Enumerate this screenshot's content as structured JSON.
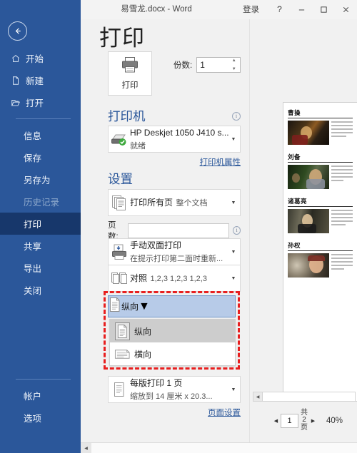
{
  "titlebar": {
    "document_title": "易雪龙.docx  -  Word",
    "sign_in": "登录",
    "help_icon": "?",
    "minimize_icon": "minimize-icon",
    "maximize_icon": "maximize-icon",
    "close_icon": "close-icon"
  },
  "page": {
    "heading": "打印"
  },
  "sidebar": {
    "back_icon": "back-arrow-icon",
    "top_items": [
      {
        "label": "开始",
        "icon": "home-icon"
      },
      {
        "label": "新建",
        "icon": "new-document-icon"
      },
      {
        "label": "打开",
        "icon": "open-folder-icon"
      }
    ],
    "main_items": [
      {
        "label": "信息",
        "state": "normal"
      },
      {
        "label": "保存",
        "state": "normal"
      },
      {
        "label": "另存为",
        "state": "normal"
      },
      {
        "label": "历史记录",
        "state": "disabled"
      },
      {
        "label": "打印",
        "state": "active"
      },
      {
        "label": "共享",
        "state": "normal"
      },
      {
        "label": "导出",
        "state": "normal"
      },
      {
        "label": "关闭",
        "state": "normal"
      }
    ],
    "bottom_items": [
      {
        "label": "帐户"
      },
      {
        "label": "选项"
      }
    ]
  },
  "print": {
    "print_button_label": "打印",
    "print_button_icon": "printer-icon",
    "copies_label": "份数:",
    "copies_value": "1",
    "printer_section_title": "打印机",
    "printer_info_icon": "info-icon",
    "printer_name": "HP Deskjet 1050 J410 s...",
    "printer_status": "就绪",
    "printer_properties_link": "打印机属性",
    "settings_section_title": "设置",
    "range": {
      "title": "打印所有页",
      "subtitle": "整个文档",
      "icon": "pages-icon"
    },
    "pages_label": "页数:",
    "pages_value": "",
    "pages_info_icon": "info-icon",
    "duplex": {
      "title": "手动双面打印",
      "subtitle": "在提示打印第二面时重新...",
      "icon": "duplex-printer-icon"
    },
    "collate": {
      "title": "对照",
      "subtitle": "1,2,3   1,2,3   1,2,3",
      "icon": "collate-icon"
    },
    "orientation": {
      "selected_label": "纵向",
      "selected_icon": "portrait-page-icon",
      "options": [
        {
          "label": "纵向",
          "icon": "portrait-page-icon",
          "selected": true
        },
        {
          "label": "横向",
          "icon": "landscape-page-icon",
          "selected": false
        }
      ],
      "highlight_color": "#e81f1f"
    },
    "scaling": {
      "title": "每版打印 1 页",
      "subtitle": "缩放到 14 厘米 x 20.3...",
      "icon": "scaling-icon"
    },
    "page_setup_link": "页面设置"
  },
  "preview": {
    "sections": [
      {
        "heading": "曹操"
      },
      {
        "heading": "刘备"
      },
      {
        "heading": "诸葛亮"
      },
      {
        "heading": "孙权"
      }
    ],
    "prev_icon": "prev-page-icon",
    "next_icon": "next-page-icon",
    "current_page": "1",
    "page_count_label": "共2页",
    "zoom_level": "40%"
  },
  "colors": {
    "backstage_blue": "#2b579a",
    "active_item_blue": "#17376b",
    "highlight_red": "#e81f1f",
    "selected_combo_blue": "#b7cbe8"
  }
}
